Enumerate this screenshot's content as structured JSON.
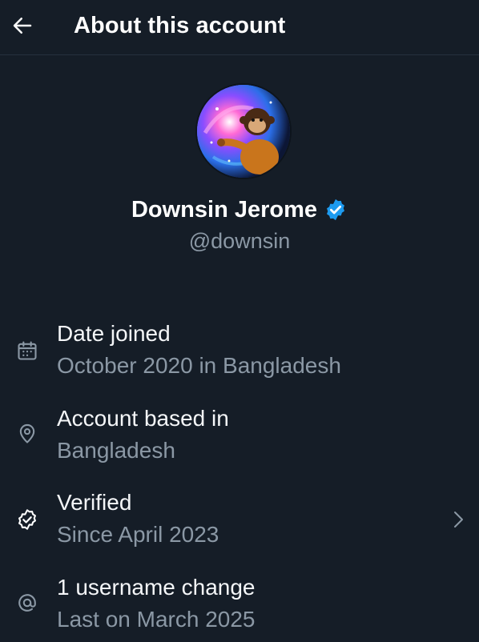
{
  "header": {
    "title": "About this account",
    "back_icon": "arrow-left-icon"
  },
  "profile": {
    "display_name": "Downsin Jerome",
    "handle": "@downsin",
    "verified": true,
    "badge_color": "#1d9bf0"
  },
  "info": [
    {
      "title": "Date joined",
      "subtitle": "October 2020 in Bangladesh",
      "icon": "calendar-icon"
    },
    {
      "title": "Account based in",
      "subtitle": "Bangladesh",
      "icon": "location-pin-icon"
    },
    {
      "title": "Verified",
      "subtitle": "Since April 2023",
      "icon": "verified-check-icon",
      "has_chevron": true
    },
    {
      "title": "1 username change",
      "subtitle": "Last on March 2025",
      "icon": "at-sign-icon"
    }
  ],
  "colors": {
    "background": "#151d27",
    "primary_text": "#ffffff",
    "secondary_text": "#8b98a5",
    "divider": "#26313d"
  }
}
